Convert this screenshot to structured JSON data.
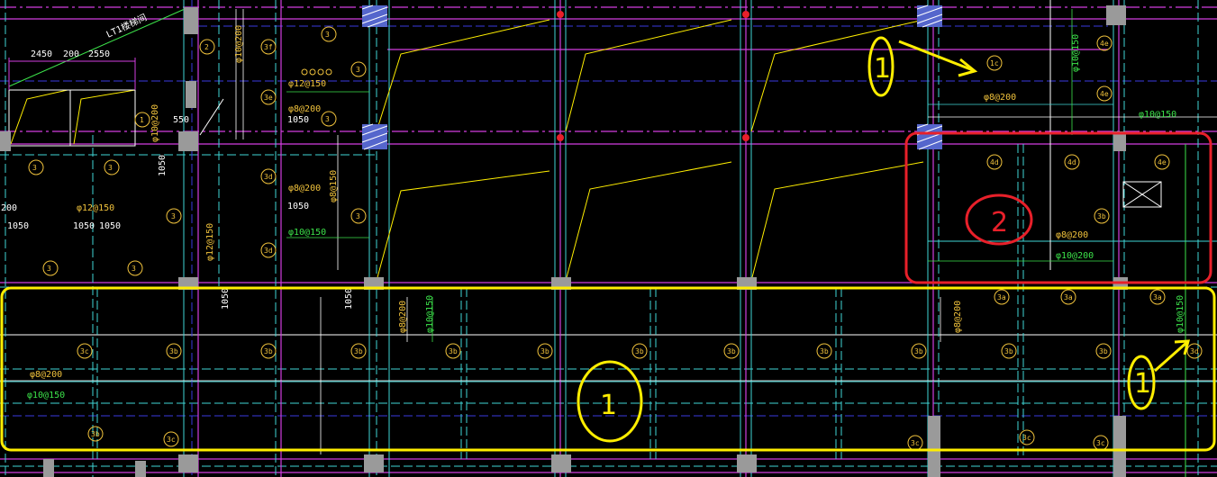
{
  "drawing": {
    "title_label": "LT1楼梯间",
    "stair_dims": [
      "2450",
      "200",
      "2550"
    ],
    "dim_1050": "1050",
    "dim_200": "200",
    "dim_550": "550",
    "rebar_labels": {
      "r_phi8_200": "φ8@200",
      "r_phi10_150": "φ10@150",
      "r_phi12_150": "φ12@150",
      "r_phi10_200": "φ10@200",
      "r_phi8_150": "φ8@150",
      "r_phi10_200_alt": "φ10@200"
    },
    "slab_tags": [
      "3",
      "3b",
      "3c",
      "3d",
      "3e",
      "3f",
      "4c",
      "4d",
      "4e",
      "1c",
      "1",
      "2",
      "3a"
    ],
    "markups": {
      "circle_1_label": "1",
      "circle_2_label": "2",
      "arrow_note_top": "1",
      "arrow_note_right": "1"
    },
    "colors": {
      "background": "#000000",
      "yellow_markup": "#ffee00",
      "red_markup": "#e8202a",
      "cyan": "#3fd6d6",
      "magenta": "#d23ee0",
      "blue": "#3a3ae0",
      "white": "#ffffff",
      "green": "#3ce24a",
      "tag_yellow": "#f0c23c"
    }
  }
}
